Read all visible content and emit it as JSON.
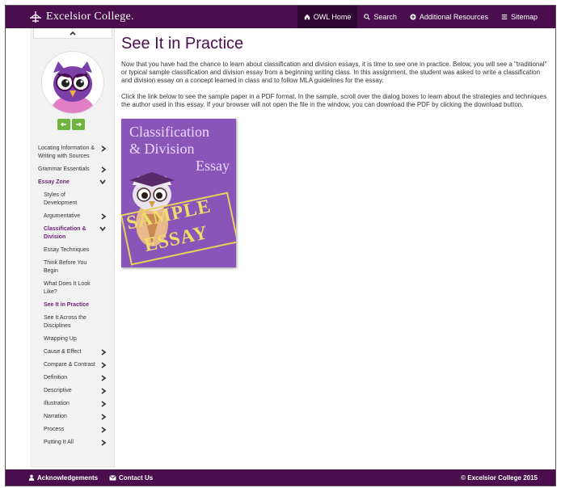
{
  "brand": {
    "name": "Excelsior College."
  },
  "nav": [
    {
      "label": "OWL Home",
      "icon": "home-icon",
      "active": true
    },
    {
      "label": "Search",
      "icon": "search-icon"
    },
    {
      "label": "Additional Resources",
      "icon": "plus-circle-icon"
    },
    {
      "label": "Sitemap",
      "icon": "list-icon"
    }
  ],
  "sidebar": {
    "items": [
      {
        "label": "Locating Information & Writing with Sources",
        "chevron": "right"
      },
      {
        "label": "Grammar Essentials",
        "chevron": "right"
      },
      {
        "label": "Essay Zone",
        "chevron": "down"
      },
      {
        "label": "Styles of Development"
      },
      {
        "label": "Argumentative",
        "chevron": "right"
      },
      {
        "label": "Classification & Division",
        "chevron": "down"
      },
      {
        "label": "Essay Techniques"
      },
      {
        "label": "Think Before You Begin"
      },
      {
        "label": "What Does It Look Like?"
      },
      {
        "label": "See It in Practice"
      },
      {
        "label": "See It Across the Disciplines"
      },
      {
        "label": "Wrapping Up"
      },
      {
        "label": "Cause & Effect",
        "chevron": "right"
      },
      {
        "label": "Compare & Contrast",
        "chevron": "right"
      },
      {
        "label": "Definition",
        "chevron": "right"
      },
      {
        "label": "Descriptive",
        "chevron": "right"
      },
      {
        "label": "Illustration",
        "chevron": "right"
      },
      {
        "label": "Narration",
        "chevron": "right"
      },
      {
        "label": "Process",
        "chevron": "right"
      },
      {
        "label": "Putting It All",
        "chevron": "right"
      }
    ]
  },
  "main": {
    "title": "See It in Practice",
    "para1": "Now that you have had the chance to learn about classification and division essays, it is time to see one in practice. Below, you will see a \"traditional\" or typical sample classification and division essay from a beginning writing class. In this assignment, the student was asked to write a classification and division essay on a concept learned in class and to follow MLA guidelines for the essay.",
    "para2": "Click the link below to see the sample paper in a PDF format. In the sample, scroll over the dialog boxes to learn about the strategies and techniques the author used in this essay. If your browser will not open the file in the window, you can download the PDF by clicking the download button.",
    "cover": {
      "line1": "Classification",
      "line2": "& Division",
      "line3": "Essay",
      "sample": "SAMPLE",
      "essay": "ESSAY"
    }
  },
  "footer": {
    "acknowledgements": "Acknowledgements",
    "contact": "Contact Us",
    "copyright": "© Excelsior College 2015"
  },
  "colors": {
    "brand": "#4a0d4e",
    "accent": "#6b1f73",
    "nav_green": "#6fb33f"
  }
}
